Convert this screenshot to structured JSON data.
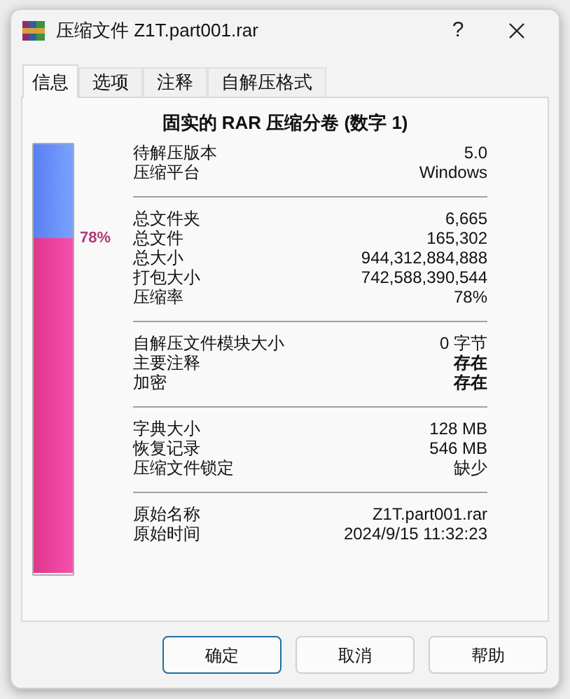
{
  "window": {
    "title": "压缩文件 Z1T.part001.rar",
    "help_glyph": "?"
  },
  "tabs": [
    {
      "label": "信息",
      "selected": true
    },
    {
      "label": "选项",
      "selected": false
    },
    {
      "label": "注释",
      "selected": false
    },
    {
      "label": "自解压格式",
      "selected": false
    }
  ],
  "heading": "固实的 RAR 压缩分卷 (数字 1)",
  "ratio_bar": {
    "level": 0.78,
    "label": "78%"
  },
  "sections": [
    {
      "rows": [
        {
          "label": "待解压版本",
          "value": "5.0",
          "bold": false
        },
        {
          "label": "压缩平台",
          "value": "Windows",
          "bold": false
        }
      ]
    },
    {
      "rows": [
        {
          "label": "总文件夹",
          "value": "6,665",
          "bold": false
        },
        {
          "label": "总文件",
          "value": "165,302",
          "bold": false
        },
        {
          "label": "总大小",
          "value": "944,312,884,888",
          "bold": false
        },
        {
          "label": "打包大小",
          "value": "742,588,390,544",
          "bold": false
        },
        {
          "label": "压缩率",
          "value": "78%",
          "bold": false
        }
      ]
    },
    {
      "rows": [
        {
          "label": "自解压文件模块大小",
          "value": "0 字节",
          "bold": false
        },
        {
          "label": "主要注释",
          "value": "存在",
          "bold": true
        },
        {
          "label": "加密",
          "value": "存在",
          "bold": true
        }
      ]
    },
    {
      "rows": [
        {
          "label": "字典大小",
          "value": "128 MB",
          "bold": false
        },
        {
          "label": "恢复记录",
          "value": "546 MB",
          "bold": false
        },
        {
          "label": "压缩文件锁定",
          "value": "缺少",
          "bold": false
        }
      ]
    },
    {
      "rows": [
        {
          "label": "原始名称",
          "value": "Z1T.part001.rar",
          "bold": false
        },
        {
          "label": "原始时间",
          "value": "2024/9/15 11:32:23",
          "bold": false
        }
      ]
    }
  ],
  "buttons": [
    {
      "label": "确定",
      "default": true
    },
    {
      "label": "取消",
      "default": false
    },
    {
      "label": "帮助",
      "default": false
    }
  ]
}
